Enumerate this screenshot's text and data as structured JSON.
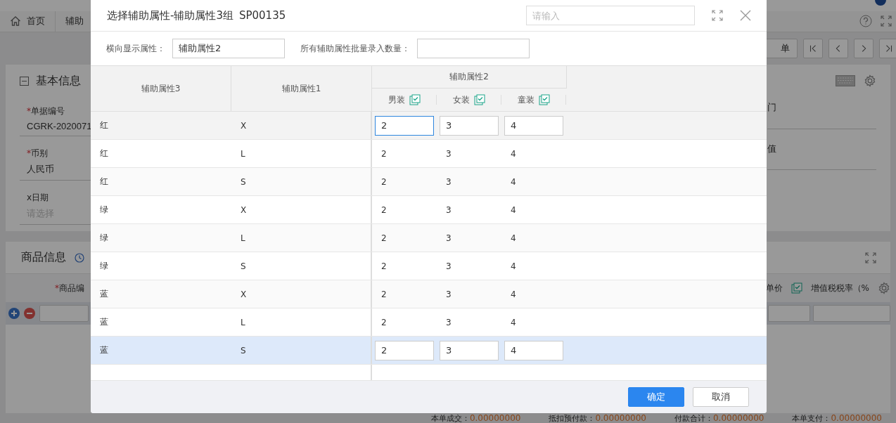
{
  "page": {
    "tabs": [
      {
        "label": "首页",
        "kind": "home"
      },
      {
        "label": "辅助",
        "kind": "plain"
      }
    ],
    "toolbar": {
      "source_button": "单"
    },
    "basic_card": {
      "title": "基本信息",
      "fields": [
        {
          "mark": "*",
          "label": "单据编号",
          "value": "CGRK-2020071"
        },
        {
          "mark": "*",
          "label": "币别",
          "value": "人民币"
        },
        {
          "label": "x日期",
          "placeholder": "请选择"
        }
      ],
      "right_fields": [
        {
          "label": "门"
        },
        {
          "label": "值"
        }
      ]
    },
    "goods_card": {
      "title": "商品信息",
      "column_mark": "*",
      "column": "商品编",
      "right_columns": [
        {
          "label": "单价",
          "checked": true
        },
        {
          "label": "增值税税率（%"
        }
      ]
    },
    "summary": [
      {
        "label": "本单成交：",
        "value": "0.00000000"
      },
      {
        "label": "抵扣预付款：",
        "value": "0.00000000"
      },
      {
        "label": "付款合计：",
        "value": "0.00000000"
      },
      {
        "label": "本单支付：",
        "value": "0.00000000"
      }
    ]
  },
  "dialog": {
    "title": "选择辅助属性-辅助属性3组",
    "code": "SP00135",
    "search": {
      "placeholder": "请输入"
    },
    "horizontal": {
      "label": "横向显示属性：",
      "value": "辅助属性2"
    },
    "batch": {
      "label": "所有辅助属性批量录入数量："
    },
    "table": {
      "columns": [
        "辅助属性3",
        "辅助属性1"
      ],
      "group": "辅助属性2",
      "sub_columns": [
        {
          "label": "男装",
          "checked": true
        },
        {
          "label": "女装",
          "checked": true
        },
        {
          "label": "童装",
          "checked": true
        }
      ],
      "rows": [
        {
          "attr3": "红",
          "attr1": "X",
          "editing": true,
          "selected": false,
          "values": [
            {
              "value": "2",
              "focused": true
            },
            {
              "value": "3",
              "focused": false
            },
            {
              "value": "4",
              "focused": false
            }
          ]
        },
        {
          "attr3": "红",
          "attr1": "L",
          "editing": false,
          "selected": false,
          "values": [
            {
              "value": "2"
            },
            {
              "value": "3"
            },
            {
              "value": "4"
            }
          ]
        },
        {
          "attr3": "红",
          "attr1": "S",
          "editing": false,
          "selected": false,
          "values": [
            {
              "value": "2"
            },
            {
              "value": "3"
            },
            {
              "value": "4"
            }
          ]
        },
        {
          "attr3": "绿",
          "attr1": "X",
          "editing": false,
          "selected": false,
          "values": [
            {
              "value": "2"
            },
            {
              "value": "3"
            },
            {
              "value": "4"
            }
          ]
        },
        {
          "attr3": "绿",
          "attr1": "L",
          "editing": false,
          "selected": false,
          "values": [
            {
              "value": "2"
            },
            {
              "value": "3"
            },
            {
              "value": "4"
            }
          ]
        },
        {
          "attr3": "绿",
          "attr1": "S",
          "editing": false,
          "selected": false,
          "values": [
            {
              "value": "2"
            },
            {
              "value": "3"
            },
            {
              "value": "4"
            }
          ]
        },
        {
          "attr3": "蓝",
          "attr1": "X",
          "editing": false,
          "selected": false,
          "values": [
            {
              "value": "2"
            },
            {
              "value": "3"
            },
            {
              "value": "4"
            }
          ]
        },
        {
          "attr3": "蓝",
          "attr1": "L",
          "editing": false,
          "selected": false,
          "values": [
            {
              "value": "2"
            },
            {
              "value": "3"
            },
            {
              "value": "4"
            }
          ]
        },
        {
          "attr3": "蓝",
          "attr1": "S",
          "editing": true,
          "selected": true,
          "values": [
            {
              "value": "2",
              "focused": false
            },
            {
              "value": "3",
              "focused": false
            },
            {
              "value": "4",
              "focused": false
            }
          ]
        }
      ]
    },
    "buttons": [
      {
        "label": "确定",
        "kind": "primary"
      },
      {
        "label": "取消",
        "kind": "default"
      }
    ]
  }
}
